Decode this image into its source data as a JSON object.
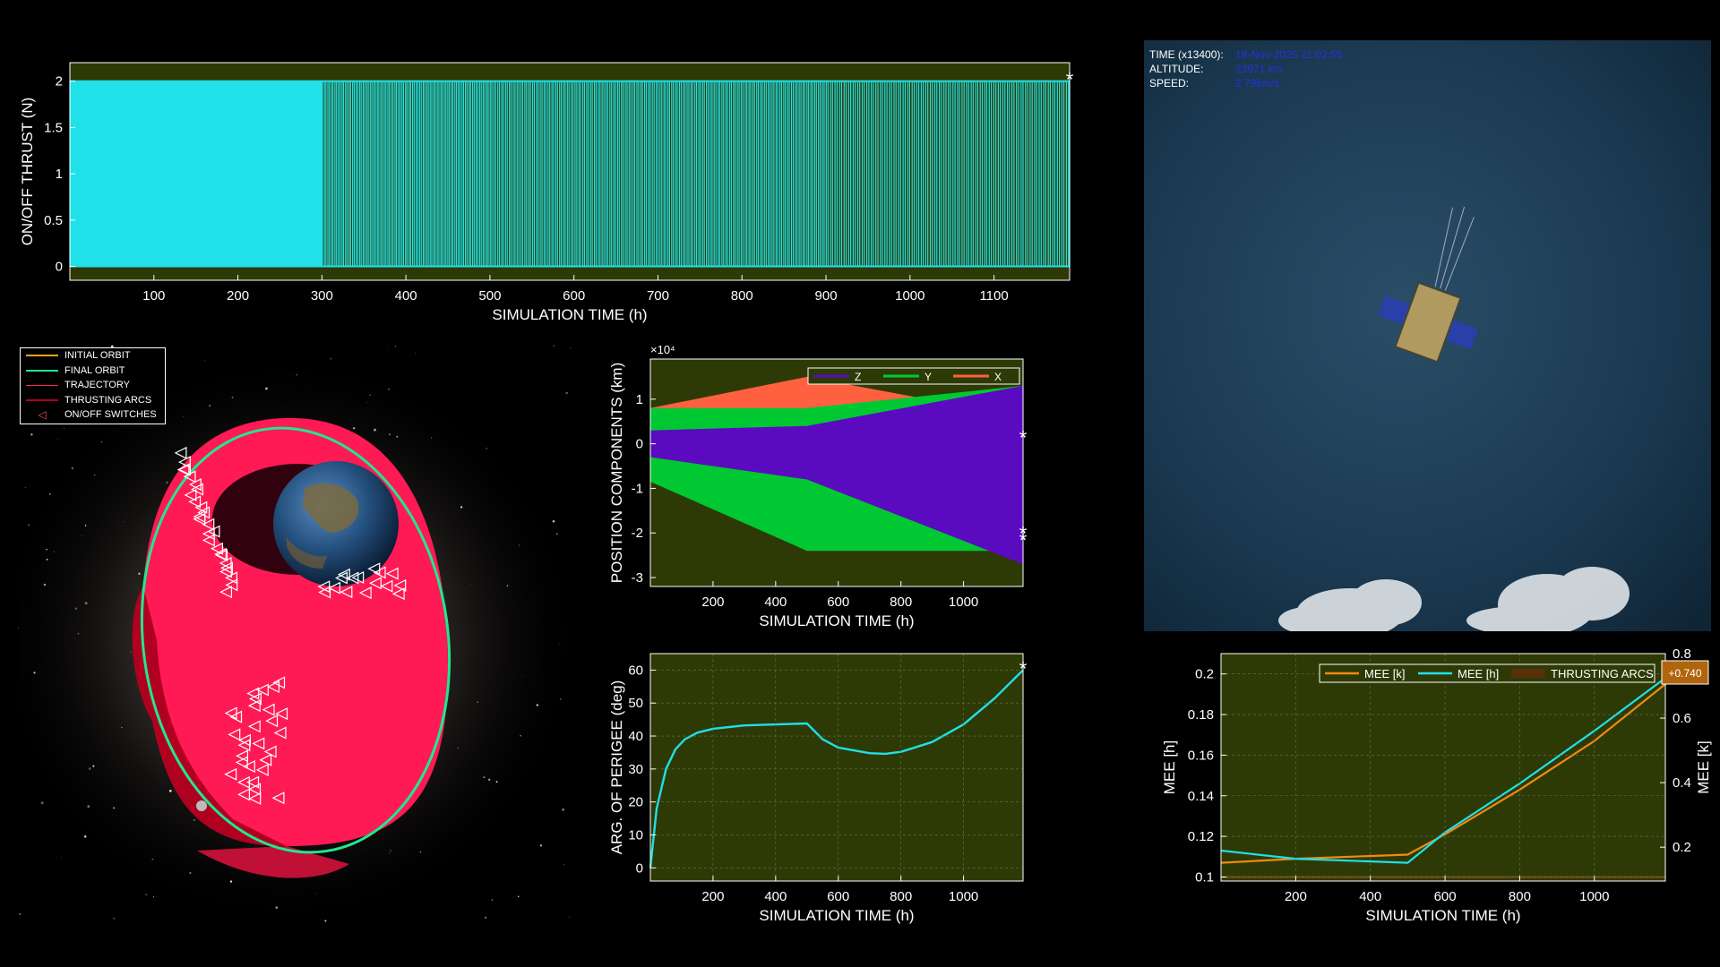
{
  "thrust_panel": {
    "ylabel": "ON/OFF THRUST (N)",
    "xlabel": "SIMULATION TIME (h)",
    "yticks": [
      "0",
      "0.5",
      "1",
      "1.5",
      "2"
    ],
    "xticks": [
      "100",
      "200",
      "300",
      "400",
      "500",
      "600",
      "700",
      "800",
      "900",
      "1000",
      "1100"
    ],
    "bg_color": "#2e3a05",
    "line_color": "#00f0ff"
  },
  "orbit_legend": {
    "items": [
      {
        "label": "INITIAL ORBIT",
        "color": "#f2a21a"
      },
      {
        "label": "FINAL ORBIT",
        "color": "#20e890"
      },
      {
        "label": "TRAJECTORY",
        "color": "#ff2060"
      },
      {
        "label": "THRUSTING ARCS",
        "color": "#b00020"
      },
      {
        "label": "ON/OFF SWITCHES",
        "color": "#ff5050"
      }
    ]
  },
  "render_hud": {
    "time_label": "TIME (x13400):",
    "time_value": "18-Nov-2025 21:02:55",
    "altitude_label": "ALTITUDE:",
    "altitude_value": "23971 km",
    "speed_label": "SPEED:",
    "speed_value": "2.79km/s"
  },
  "position_panel": {
    "exponent_label": "×10⁴",
    "legend_labels": [
      "Z",
      "Y",
      "X"
    ]
  },
  "mee_panel": {
    "badge_value": "+0.740",
    "legend_labels": [
      "MEE [k]",
      "MEE [h]",
      "THRUSTING ARCS"
    ]
  },
  "colors": {
    "plot_bg": "#2e3a05",
    "cyan": "#20e0e8",
    "z_series": "#5a0bc0",
    "y_series": "#00c832",
    "x_series": "#ff6040",
    "mee_k": "#f08a10"
  },
  "chart_data": [
    {
      "id": "thrust",
      "type": "line",
      "xlabel": "SIMULATION TIME (h)",
      "ylabel": "ON/OFF THRUST (N)",
      "xlim": [
        0,
        1190
      ],
      "ylim": [
        -0.15,
        2.2
      ],
      "yticks": [
        0,
        0.5,
        1,
        1.5,
        2
      ],
      "xticks": [
        100,
        200,
        300,
        400,
        500,
        600,
        700,
        800,
        900,
        1000,
        1100
      ],
      "series": [
        {
          "values_description_levels": [
            0,
            2
          ],
          "values": [
            0,
            2
          ]
        }
      ],
      "end_marker": {
        "x": 1190,
        "y": 2
      }
    },
    {
      "id": "position",
      "type": "area",
      "xlabel": "SIMULATION TIME (h)",
      "ylabel": "POSITION COMPONENTS (km)",
      "exponent": "x10^4",
      "xlim": [
        0,
        1190
      ],
      "ylim": [
        -3.2,
        1.9
      ],
      "yticks": [
        -3,
        -2,
        -1,
        0,
        1
      ],
      "xticks": [
        200,
        400,
        600,
        800,
        1000
      ],
      "legend": [
        "Z",
        "Y",
        "X"
      ],
      "series": [
        {
          "name": "X",
          "x": [
            0,
            500,
            1190
          ],
          "upper": [
            0.8,
            1.5,
            0.6
          ],
          "lower": [
            -0.8,
            -0.8,
            -2.4
          ]
        },
        {
          "name": "Y",
          "x": [
            0,
            500,
            1190
          ],
          "upper": [
            0.8,
            0.8,
            1.3
          ],
          "lower": [
            -0.85,
            -2.4,
            -2.4
          ]
        },
        {
          "name": "Z",
          "x": [
            0,
            500,
            1190
          ],
          "upper": [
            0.3,
            0.4,
            1.3
          ],
          "lower": [
            -0.3,
            -0.8,
            -2.7
          ]
        }
      ],
      "end_markers": [
        {
          "x": 1190,
          "y": 0.1
        },
        {
          "x": 1190,
          "y": -2.05
        },
        {
          "x": 1190,
          "y": -2.2
        }
      ]
    },
    {
      "id": "perigee",
      "type": "line",
      "xlabel": "SIMULATION TIME (h)",
      "ylabel": "ARG. OF PERIGEE (deg)",
      "xlim": [
        0,
        1190
      ],
      "ylim": [
        -4,
        65
      ],
      "yticks": [
        0,
        10,
        20,
        30,
        40,
        50,
        60
      ],
      "xticks": [
        200,
        400,
        600,
        800,
        1000
      ],
      "series": [
        {
          "x": [
            0,
            20,
            50,
            80,
            110,
            150,
            200,
            300,
            400,
            500,
            550,
            600,
            700,
            750,
            800,
            900,
            1000,
            1100,
            1190
          ],
          "y": [
            0,
            18,
            30,
            36,
            39,
            41,
            42.2,
            43.2,
            43.5,
            43.8,
            39,
            36.5,
            34.8,
            34.6,
            35.2,
            38.2,
            43.5,
            51.5,
            60
          ]
        }
      ],
      "end_marker": {
        "x": 1190,
        "y": 60
      }
    },
    {
      "id": "mee",
      "type": "line",
      "xlabel": "SIMULATION TIME (h)",
      "ylabel": "MEE [h]",
      "ylabel_right": "MEE [k]",
      "xlim": [
        0,
        1190
      ],
      "ylim": [
        0.098,
        0.21
      ],
      "ylim_right": [
        0.095,
        0.8
      ],
      "yticks": [
        0.1,
        0.12,
        0.14,
        0.16,
        0.18,
        0.2
      ],
      "yticks_right": [
        0.2,
        0.4,
        0.6,
        0.8
      ],
      "xticks": [
        200,
        400,
        600,
        800,
        1000
      ],
      "legend": [
        "MEE [k]",
        "MEE [h]",
        "THRUSTING ARCS"
      ],
      "series": [
        {
          "name": "MEE [k]",
          "x": [
            0,
            200,
            500,
            600,
            800,
            1000,
            1190
          ],
          "y": [
            0.107,
            0.109,
            0.111,
            0.121,
            0.143,
            0.167,
            0.195
          ]
        },
        {
          "name": "MEE [h]",
          "x": [
            0,
            200,
            500,
            600,
            800,
            1000,
            1190
          ],
          "y": [
            0.113,
            0.109,
            0.107,
            0.122,
            0.146,
            0.172,
            0.198
          ]
        }
      ],
      "badge": "+0.740"
    }
  ]
}
